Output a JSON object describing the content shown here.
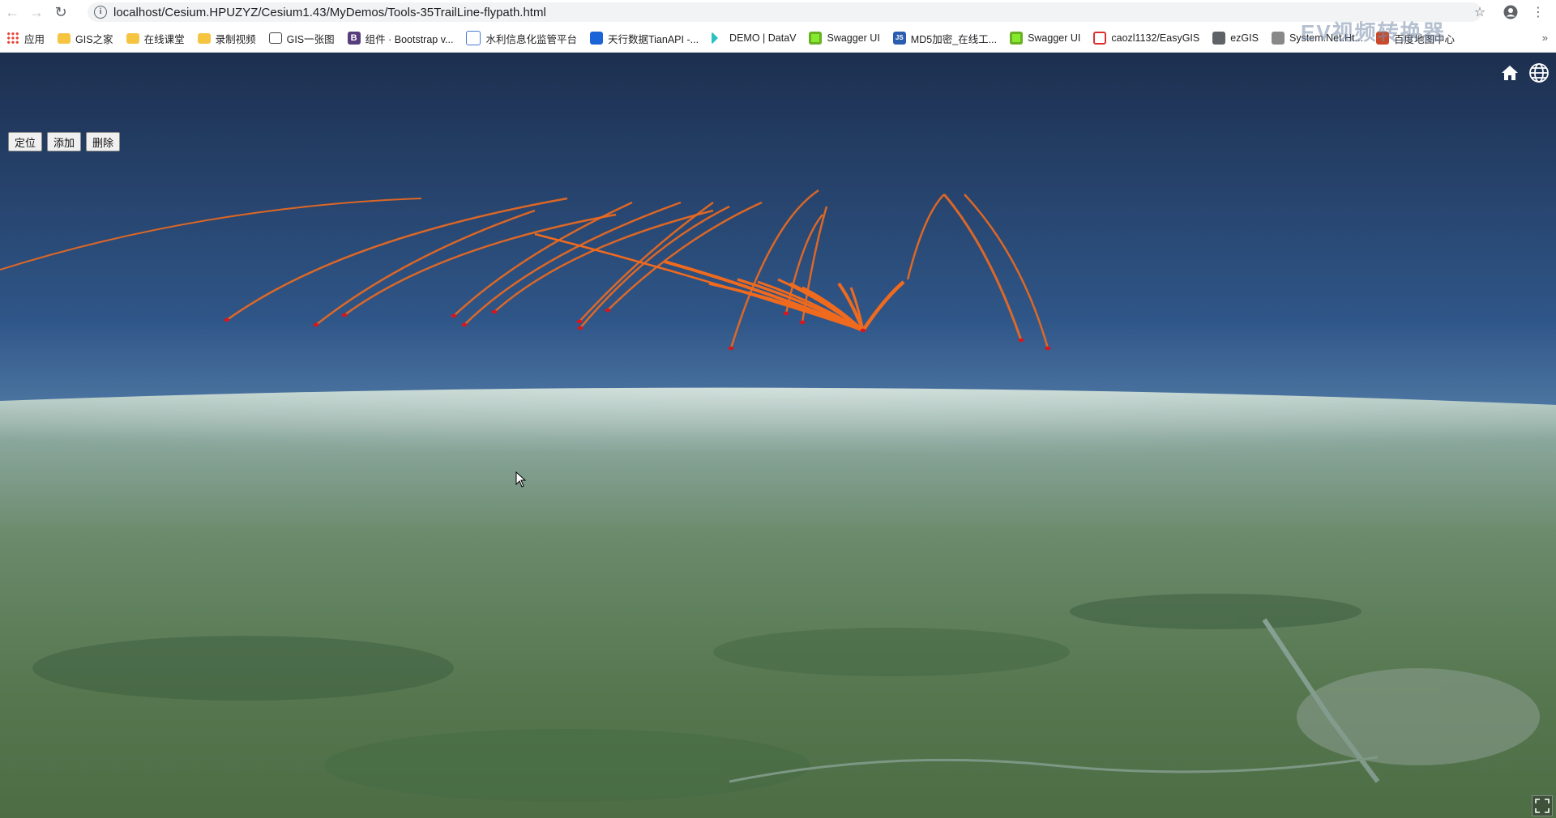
{
  "browser": {
    "url": "localhost/Cesium.HPUZYZ/Cesium1.43/MyDemos/Tools-35TrailLine-flypath.html",
    "bookmarks": [
      {
        "label": "应用",
        "icon": "apps-icon"
      },
      {
        "label": "GIS之家",
        "icon": "folder-icon"
      },
      {
        "label": "在线课堂",
        "icon": "folder-icon"
      },
      {
        "label": "录制视频",
        "icon": "folder-icon"
      },
      {
        "label": "GIS一张图",
        "icon": "image-icon"
      },
      {
        "label": "组件 · Bootstrap v...",
        "icon": "bootstrap-icon"
      },
      {
        "label": "水利信息化监管平台",
        "icon": "water-icon"
      },
      {
        "label": "天行数据TianAPI -...",
        "icon": "tianapi-icon"
      },
      {
        "label": "DEMO | DataV",
        "icon": "datav-icon"
      },
      {
        "label": "Swagger UI",
        "icon": "swagger-icon"
      },
      {
        "label": "MD5加密_在线工...",
        "icon": "js-icon"
      },
      {
        "label": "Swagger UI",
        "icon": "swagger-icon"
      },
      {
        "label": "caozl1132/EasyGIS",
        "icon": "g-icon"
      },
      {
        "label": "ezGIS",
        "icon": "globe-icon"
      },
      {
        "label": "System.Net.Ht...",
        "icon": "system-icon"
      },
      {
        "label": "百度地图中心",
        "icon": "star-icon"
      }
    ],
    "more_label": "»",
    "watermark": "EV视频转换器"
  },
  "viewer": {
    "buttons": [
      {
        "label": "定位"
      },
      {
        "label": "添加"
      },
      {
        "label": "删除"
      }
    ],
    "home_icon": "home-icon",
    "scene_mode_icon": "globe-icon",
    "fullscreen_icon": "fullscreen-icon"
  },
  "colors": {
    "trail": "#f06a1e",
    "endpoint": "#d9161b",
    "sky_top": "#1d2f4f",
    "horizon": "#cfe2ec",
    "ground": "#53744d"
  }
}
